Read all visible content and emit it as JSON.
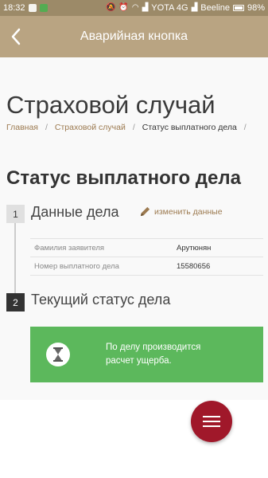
{
  "status_bar": {
    "time": "18:32",
    "network_1": "YOTA 4G",
    "network_2": "Beeline",
    "battery": "98%"
  },
  "app_bar": {
    "title": "Аварийная кнопка",
    "back_icon": "chevron-left-icon"
  },
  "page": {
    "title": "Страховой случай",
    "breadcrumb": [
      {
        "label": "Главная"
      },
      {
        "label": "Страховой случай"
      },
      {
        "label": "Статус выплатного дела"
      }
    ],
    "breadcrumb_separator": "/"
  },
  "section": {
    "title": "Статус выплатного дела"
  },
  "steps": [
    {
      "number": "1",
      "title": "Данные дела",
      "edit_label": "изменить данные"
    },
    {
      "number": "2",
      "title": "Текущий статус дела"
    }
  ],
  "case_details": [
    {
      "label": "Фамилия заявителя",
      "value": "Арутюнян"
    },
    {
      "label": "Номер выплатного дела",
      "value": "15580656"
    }
  ],
  "status_message": {
    "text": "По делу производится расчет ущерба.",
    "icon": "hourglass-icon",
    "color": "#5cb85c"
  },
  "colors": {
    "brand": "#b9a482",
    "link": "#9c7a50",
    "fab": "#a0182a"
  }
}
